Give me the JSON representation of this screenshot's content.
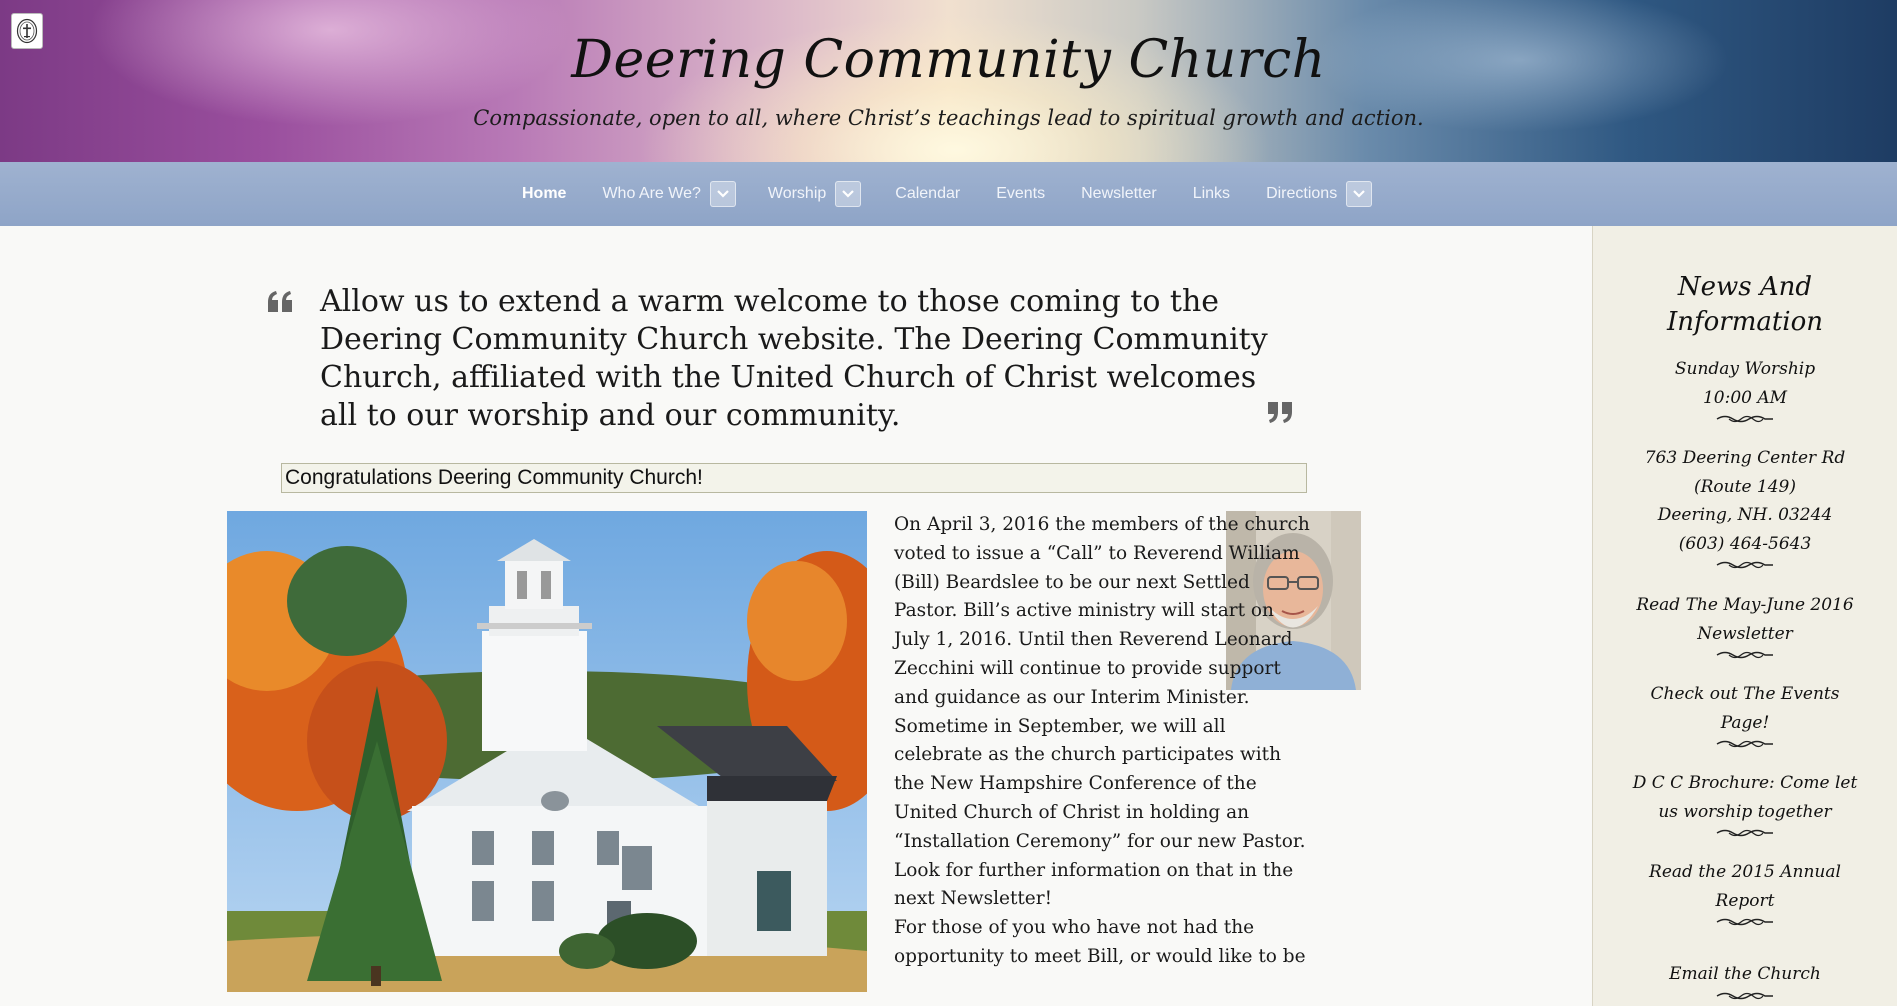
{
  "header": {
    "title": "Deering Community Church",
    "tagline": "Compassionate, open to all, where Christ’s teachings lead to spiritual growth and action."
  },
  "nav": {
    "items": [
      {
        "label": "Home"
      },
      {
        "label": "Who Are We?"
      },
      {
        "label": "Worship"
      },
      {
        "label": "Calendar"
      },
      {
        "label": "Events"
      },
      {
        "label": "Newsletter"
      },
      {
        "label": "Links"
      },
      {
        "label": "Directions"
      }
    ]
  },
  "main": {
    "welcome": "Allow us to extend a warm welcome to those coming to the Deering Community Church website. The Deering Community Church, affiliated with the United Church of Christ welcomes all to our worship and our community.",
    "congrats_heading": "Congratulations Deering Community Church!",
    "story_p1": "On April 3, 2016 the members of the church voted to issue a “Call” to Reverend William (Bill) Beardslee to be our next Settled Pastor. Bill’s active ministry will start on July 1, 2016. Until then Reverend Leonard Zecchini will continue to provide support and guidance as our Interim Minister. Sometime in September, we will all celebrate as the church participates with the New Hampshire Conference of the United Church of Christ in holding an “Installation Ceremony” for our new Pastor. Look for further information on that in the next Newsletter!",
    "story_p2": "For those of you who have not had the opportunity to meet Bill, or would like to be"
  },
  "sidebar": {
    "title_line1": "News And",
    "title_line2": "Information",
    "worship_line1": "Sunday Worship",
    "worship_line2": "10:00 AM",
    "address_line1": "763 Deering Center Rd",
    "address_line2": "(Route 149)",
    "address_line3": "Deering, NH. 03244",
    "address_line4": "(603) 464-5643",
    "newsletter_line1": "Read The May-June 2016",
    "newsletter_line2": "Newsletter",
    "events_line1": "Check out The Events",
    "events_line2": "Page!",
    "brochure_line1": "D C C Brochure: Come let",
    "brochure_line2": "us worship together",
    "report_line1": "Read the 2015 Annual",
    "report_line2": "Report",
    "email": "Email the Church"
  },
  "icons": {
    "quote_open": "open-quote-icon",
    "quote_close": "close-quote-icon",
    "nav_toggle": "chevron-down-icon",
    "flourish": "flourish-divider-icon",
    "site_logo": "church-seal-icon"
  },
  "colors": {
    "nav_bg": "#8ea4c7",
    "sidebar_bg": "#f1efe5",
    "page_bg": "#f9f9f7",
    "quote_mark": "#666666"
  }
}
